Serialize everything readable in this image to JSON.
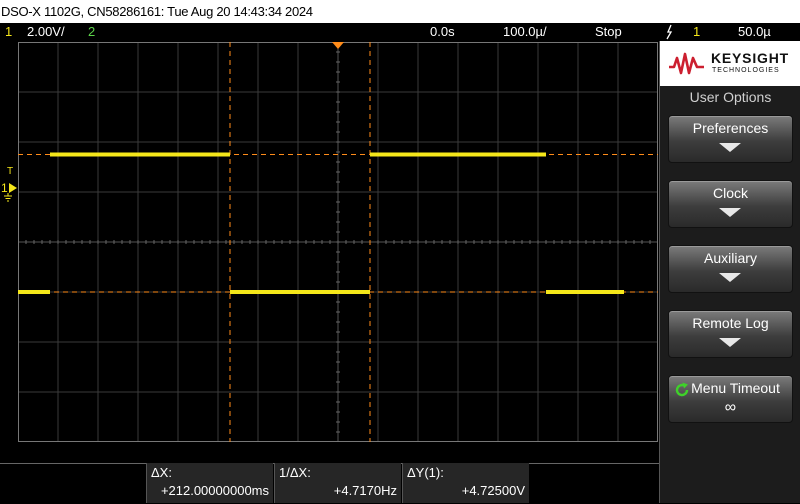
{
  "window": {
    "title": "DSO-X 1102G, CN58286161: Tue Aug 20 14:43:34 2024"
  },
  "status": {
    "ch1_number": "1",
    "ch1_scale": "2.00V/",
    "ch2_number": "2",
    "time_offset": "0.0s",
    "time_scale": "100.0µ/",
    "run_state": "Stop",
    "trigger_icon": "trigger-edge-icon",
    "trigger_channel": "1",
    "trigger_level": "50.0µ"
  },
  "colors": {
    "ch1": "#f5e71a",
    "ch2": "#5cd24a",
    "cursor": "#ff8c1a",
    "brand": "#cc1f2f"
  },
  "display": {
    "ch1_marker": "1",
    "trigger_marker": "T"
  },
  "panel": {
    "brand_name": "KEYSIGHT",
    "brand_sub": "TECHNOLOGIES",
    "title": "User Options",
    "softkeys": [
      {
        "label": "Preferences",
        "icon": "arrow-down-icon"
      },
      {
        "label": "Clock",
        "icon": "arrow-down-icon"
      },
      {
        "label": "Auxiliary",
        "icon": "arrow-down-icon"
      },
      {
        "label": "Remote Log",
        "icon": "arrow-down-icon"
      },
      {
        "label": "Menu Timeout",
        "icon": "refresh-icon",
        "value": "∞"
      }
    ]
  },
  "measurements": {
    "delta_x_label": "ΔX:",
    "delta_x_value": "+212.00000000ms",
    "inv_delta_x_label": "1/ΔX:",
    "inv_delta_x_value": "+4.7170Hz",
    "delta_y_label": "ΔY(1):",
    "delta_y_value": "+4.72500V"
  },
  "waveform": {
    "channel": 1,
    "high_level_div": 5.75,
    "low_level_div": 3.0,
    "segments": [
      {
        "start_div": 0.0,
        "end_div": 0.8,
        "level": "low"
      },
      {
        "start_div": 0.8,
        "end_div": 5.3,
        "level": "high"
      },
      {
        "start_div": 5.3,
        "end_div": 8.8,
        "level": "low"
      },
      {
        "start_div": 8.8,
        "end_div": 13.2,
        "level": "high"
      },
      {
        "start_div": 13.2,
        "end_div": 15.15,
        "level": "low"
      }
    ],
    "cursor_x_div": [
      5.3,
      8.8
    ],
    "cursor_y_div": [
      5.75,
      3.0
    ]
  }
}
